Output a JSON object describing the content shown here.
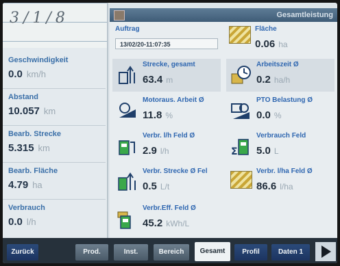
{
  "sketch": {
    "text": "3/1/8"
  },
  "left": [
    {
      "label": "Geschwindigkeit",
      "value": "0.0",
      "unit": "km/h"
    },
    {
      "label": "Abstand",
      "value": "10.057",
      "unit": "km"
    },
    {
      "label": "Bearb. Strecke",
      "value": "5.315",
      "unit": "km"
    },
    {
      "label": "Bearb. Fläche",
      "value": "4.79",
      "unit": "ha"
    },
    {
      "label": "Verbrauch",
      "value": "0.0",
      "unit": "l/h"
    }
  ],
  "panel": {
    "title": "Gesamtleistung",
    "auftrag": {
      "label": "Auftrag",
      "date": "13/02/20-11:07:35"
    },
    "flaeche": {
      "label": "Fläche",
      "value": "0.06",
      "unit": "ha"
    },
    "strecke": {
      "label": "Strecke, gesamt",
      "value": "63.4",
      "unit": "m"
    },
    "arbeitszeit": {
      "label": "Arbeitszeit Ø",
      "value": "0.2",
      "unit": "ha/h"
    },
    "motor": {
      "label": "Motoraus. Arbeit Ø",
      "value": "11.8",
      "unit": "%"
    },
    "pto": {
      "label": "PTO Belastung Ø",
      "value": "0.0",
      "unit": "%"
    },
    "verbr_lh": {
      "label": "Verbr. l/h Feld Ø",
      "value": "2.9",
      "unit": "l/h"
    },
    "verbr_feld": {
      "label": "Verbrauch Feld",
      "value": "5.0",
      "unit": "L"
    },
    "verbr_strecke": {
      "label": "Verbr. Strecke Ø Fel",
      "value": "0.5",
      "unit": "L/t"
    },
    "verbr_lha": {
      "label": "Verbr. l/ha Feld Ø",
      "value": "86.6",
      "unit": "l/ha"
    },
    "verbr_eff": {
      "label": "Verbr.Eff. Feld Ø",
      "value": "45.2",
      "unit": "kWh/L"
    }
  },
  "tabs": {
    "zurueck": "Zurück",
    "prod": "Prod.",
    "inst": "Inst.",
    "bereich": "Bereich",
    "gesamt": "Gesamt",
    "profil": "Profil",
    "daten": "Daten 1"
  },
  "colors": {
    "accent": "#2e66b0",
    "value": "#1f2c3a",
    "header": "#4a6782"
  }
}
